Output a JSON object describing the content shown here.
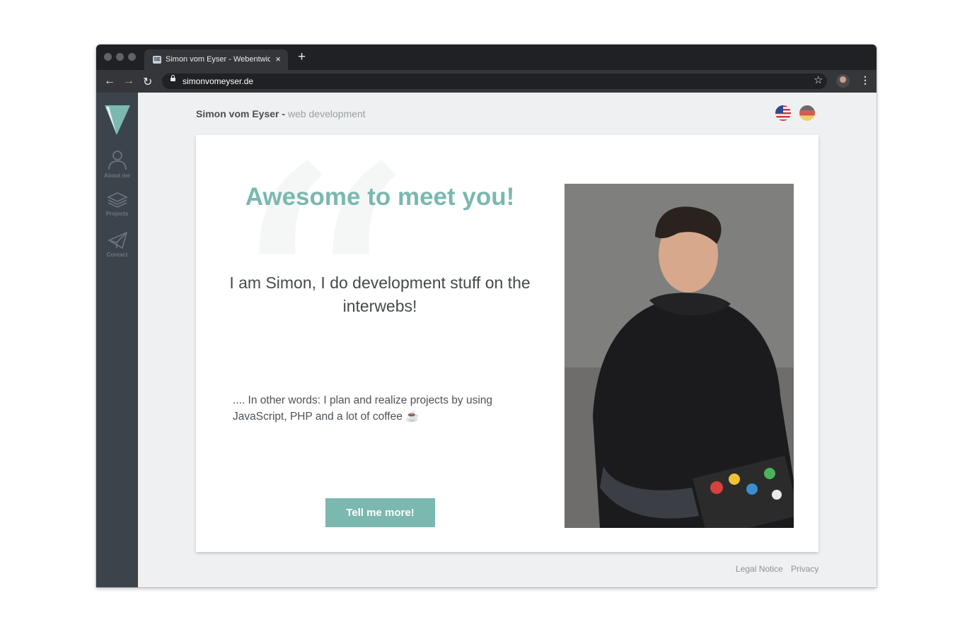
{
  "browser": {
    "tab_title": "Simon vom Eyser - Webentwickl",
    "tab_favicon": "SE",
    "tab_close": "×",
    "new_tab": "+",
    "url": "simonvomeyser.de",
    "icons": [
      "back-icon",
      "forward-icon",
      "reload-icon",
      "lock-icon",
      "star-icon",
      "profile-avatar",
      "more-icon"
    ]
  },
  "sidebar": {
    "logo": "v-triangle-logo",
    "items": [
      {
        "label": "About me",
        "icon": "person-icon"
      },
      {
        "label": "Projects",
        "icon": "layers-icon"
      },
      {
        "label": "Contact",
        "icon": "paper-plane-icon"
      }
    ]
  },
  "header": {
    "name": "Simon vom Eyser",
    "separator": " - ",
    "subtitle": "web development",
    "languages": [
      "flag-us-icon",
      "flag-de-icon"
    ]
  },
  "hero": {
    "headline": "Awesome to meet you!",
    "tagline": "I am Simon, I do development stuff on the interwebs!",
    "description": ".... In other words: I plan and realize projects by using JavaScript, PHP and a lot of coffee ☕",
    "cta_label": "Tell me more!",
    "photo": "portrait-photo"
  },
  "footer": {
    "links": [
      "Legal Notice",
      "Privacy"
    ]
  },
  "colors": {
    "accent": "#7ab8b0",
    "sidebar": "#3c444b",
    "chrome_dark": "#202124"
  }
}
